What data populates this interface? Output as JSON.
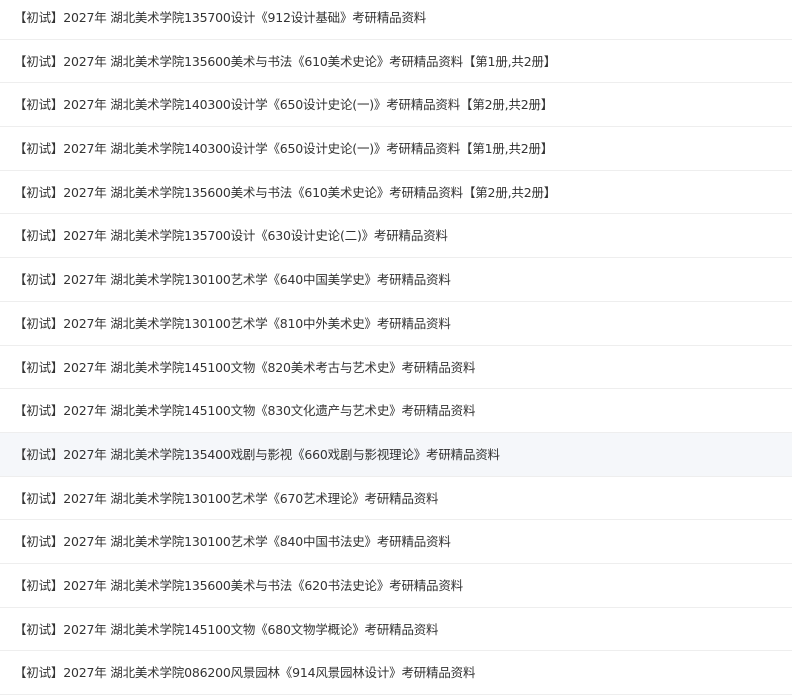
{
  "list": {
    "items": [
      {
        "title": "【初试】2027年 湖北美术学院135700设计《912设计基础》考研精品资料"
      },
      {
        "title": "【初试】2027年 湖北美术学院135600美术与书法《610美术史论》考研精品资料【第1册,共2册】"
      },
      {
        "title": "【初试】2027年 湖北美术学院140300设计学《650设计史论(一)》考研精品资料【第2册,共2册】"
      },
      {
        "title": "【初试】2027年 湖北美术学院140300设计学《650设计史论(一)》考研精品资料【第1册,共2册】"
      },
      {
        "title": "【初试】2027年 湖北美术学院135600美术与书法《610美术史论》考研精品资料【第2册,共2册】"
      },
      {
        "title": "【初试】2027年 湖北美术学院135700设计《630设计史论(二)》考研精品资料"
      },
      {
        "title": "【初试】2027年 湖北美术学院130100艺术学《640中国美学史》考研精品资料"
      },
      {
        "title": "【初试】2027年 湖北美术学院130100艺术学《810中外美术史》考研精品资料"
      },
      {
        "title": "【初试】2027年 湖北美术学院145100文物《820美术考古与艺术史》考研精品资料"
      },
      {
        "title": "【初试】2027年 湖北美术学院145100文物《830文化遗产与艺术史》考研精品资料"
      },
      {
        "title": "【初试】2027年 湖北美术学院135400戏剧与影视《660戏剧与影视理论》考研精品资料"
      },
      {
        "title": "【初试】2027年 湖北美术学院130100艺术学《670艺术理论》考研精品资料"
      },
      {
        "title": "【初试】2027年 湖北美术学院130100艺术学《840中国书法史》考研精品资料"
      },
      {
        "title": "【初试】2027年 湖北美术学院135600美术与书法《620书法史论》考研精品资料"
      },
      {
        "title": "【初试】2027年 湖北美术学院145100文物《680文物学概论》考研精品资料"
      },
      {
        "title": "【初试】2027年 湖北美术学院086200风景园林《914风景园林设计》考研精品资料"
      }
    ]
  }
}
